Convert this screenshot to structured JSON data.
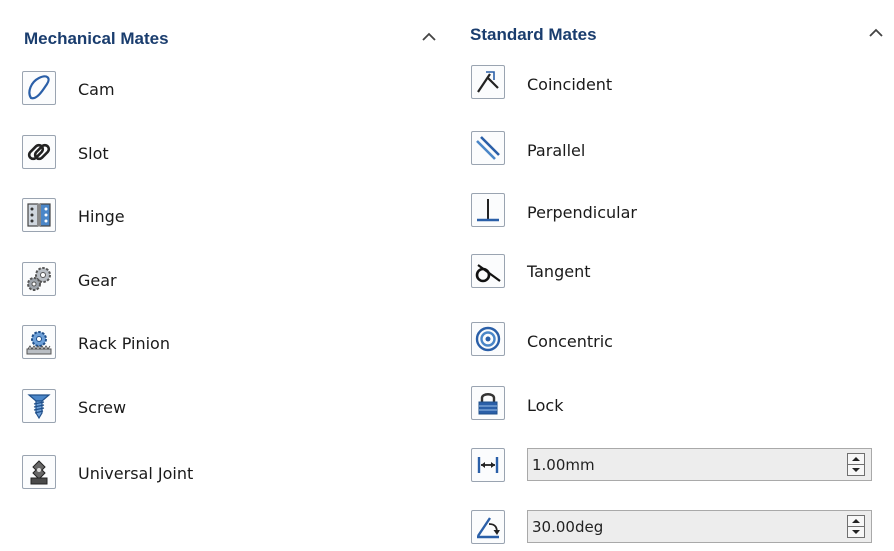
{
  "mechanical": {
    "title": "Mechanical Mates",
    "items": [
      {
        "label": "Cam",
        "icon": "cam-icon"
      },
      {
        "label": "Slot",
        "icon": "slot-icon"
      },
      {
        "label": "Hinge",
        "icon": "hinge-icon"
      },
      {
        "label": "Gear",
        "icon": "gear-icon"
      },
      {
        "label": "Rack Pinion",
        "icon": "rack-pinion-icon"
      },
      {
        "label": "Screw",
        "icon": "screw-icon"
      },
      {
        "label": "Universal Joint",
        "icon": "universal-joint-icon"
      }
    ]
  },
  "standard": {
    "title": "Standard Mates",
    "items": [
      {
        "label": "Coincident",
        "icon": "coincident-icon"
      },
      {
        "label": "Parallel",
        "icon": "parallel-icon"
      },
      {
        "label": "Perpendicular",
        "icon": "perpendicular-icon"
      },
      {
        "label": "Tangent",
        "icon": "tangent-icon"
      },
      {
        "label": "Concentric",
        "icon": "concentric-icon"
      },
      {
        "label": "Lock",
        "icon": "lock-icon"
      }
    ],
    "distance": {
      "value": "1.00mm",
      "icon": "distance-icon"
    },
    "angle": {
      "value": "30.00deg",
      "icon": "angle-icon"
    }
  },
  "colors": {
    "header": "#1a3d6e",
    "icon_blue": "#2a5fa8",
    "border": "#9aa4b1"
  }
}
